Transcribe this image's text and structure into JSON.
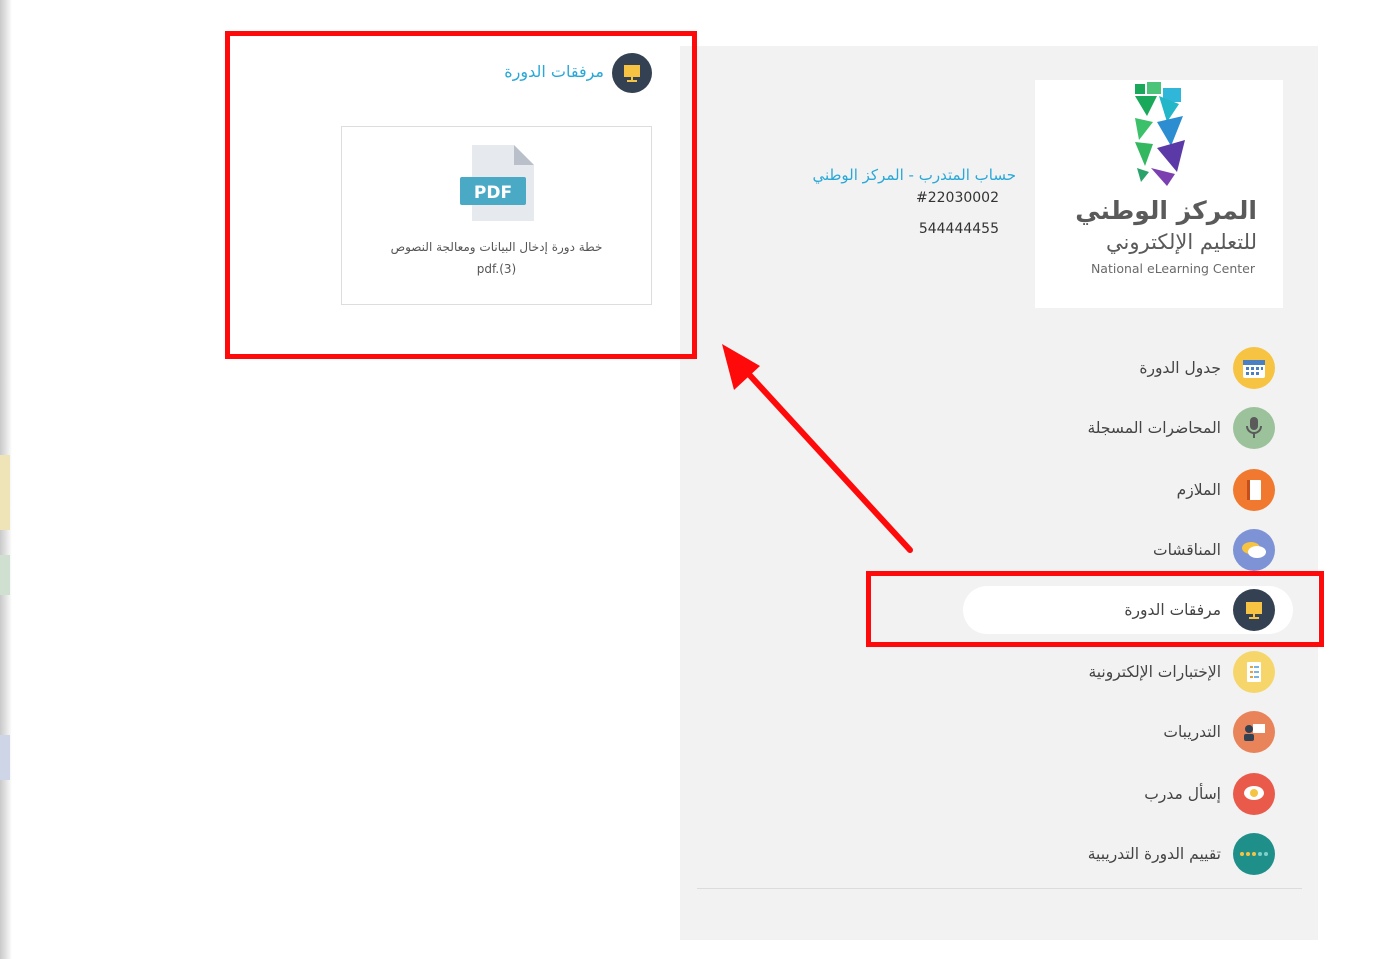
{
  "brand": {
    "name_ar_line1": "المركز الوطني",
    "name_ar_line2": "للتعليم الإلكتروني",
    "name_en": "National eLearning Center"
  },
  "account": {
    "title": "حساب المتدرب - المركز الوطني",
    "id": "#22030002",
    "phone": "544444455"
  },
  "menu": {
    "items": [
      {
        "label": "جدول الدورة",
        "icon": "calendar-icon",
        "color": "#f6c343"
      },
      {
        "label": "المحاضرات المسجلة",
        "icon": "microphone-icon",
        "color": "#9bc29b"
      },
      {
        "label": "الملازم",
        "icon": "notebook-icon",
        "color": "#f0792f"
      },
      {
        "label": "المناقشات",
        "icon": "chat-bubbles-icon",
        "color": "#7d93d6"
      },
      {
        "label": "مرفقات الدورة",
        "icon": "folder-presentation-icon",
        "color": "#344152",
        "active": true
      },
      {
        "label": "الإختبارات الإلكترونية",
        "icon": "test-sheet-icon",
        "color": "#f6d66a"
      },
      {
        "label": "التدريبات",
        "icon": "trainer-board-icon",
        "color": "#e8835a"
      },
      {
        "label": "إسأل مدرب",
        "icon": "question-chat-icon",
        "color": "#ea5a4b"
      },
      {
        "label": "تقييم الدورة التدريبية",
        "icon": "rating-stars-icon",
        "color": "#1f8f8a"
      }
    ]
  },
  "attachments": {
    "title": "مرفقات الدورة",
    "files": [
      {
        "type_label": "PDF",
        "name": "خطة دورة إدخال البيانات ومعالجة النصوص",
        "ext": "pdf.(3)"
      }
    ]
  },
  "colors": {
    "accent": "#29a8d8",
    "highlight": "#ff0a0a",
    "panel": "#f2f2f2"
  }
}
